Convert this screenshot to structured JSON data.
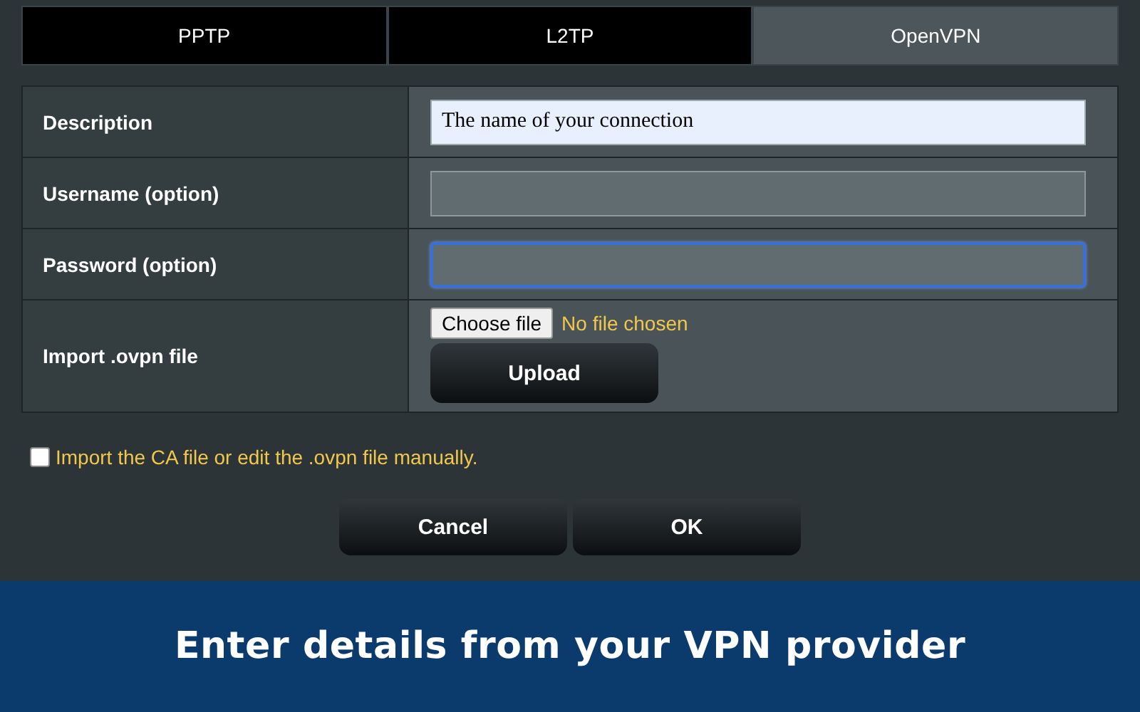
{
  "tabs": [
    {
      "label": "PPTP",
      "selected": false
    },
    {
      "label": "L2TP",
      "selected": false
    },
    {
      "label": "OpenVPN",
      "selected": true
    }
  ],
  "form": {
    "rows": [
      {
        "kind": "text",
        "label": "Description",
        "value": "The name of your connection",
        "focused": false
      },
      {
        "kind": "text",
        "label": "Username (option)",
        "focused": false
      },
      {
        "kind": "password",
        "label": "Password (option)",
        "focused": true
      },
      {
        "kind": "file",
        "label": "Import .ovpn file",
        "choose_button": "Choose file",
        "file_status": "No file chosen",
        "upload_button": "Upload"
      }
    ]
  },
  "manual_option": {
    "label": "Import the CA file or edit the .ovpn file manually.",
    "checked": false
  },
  "buttons": [
    "Cancel",
    "OK"
  ],
  "caption": "Enter details from your VPN provider"
}
